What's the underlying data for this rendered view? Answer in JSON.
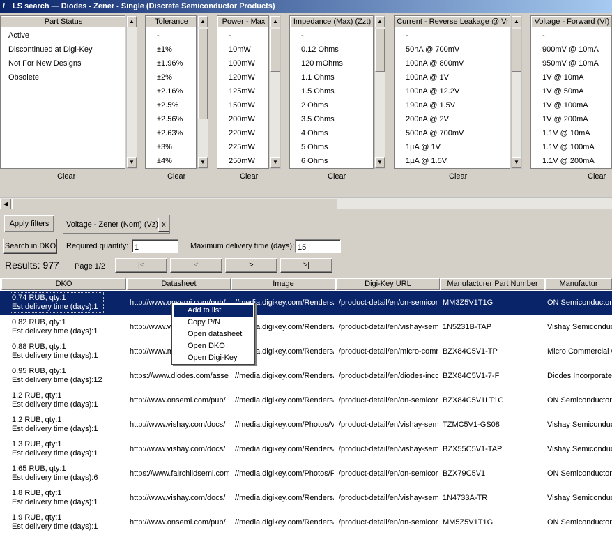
{
  "window": {
    "title": "LS search — Diodes - Zener - Single (Discrete Semiconductor Products)"
  },
  "filters": [
    {
      "header": "Part Status",
      "items": [
        "Active",
        "Discontinued at Digi-Key",
        "Not For New Designs",
        "Obsolete"
      ],
      "clear_label": "Clear"
    },
    {
      "header": "Tolerance",
      "items": [
        "-",
        "±1%",
        "±1.96%",
        "±2%",
        "±2.16%",
        "±2.5%",
        "±2.56%",
        "±2.63%",
        "±3%",
        "±4%"
      ],
      "clear_label": "Clear"
    },
    {
      "header": "Power - Max",
      "items": [
        "-",
        "10mW",
        "100mW",
        "120mW",
        "125mW",
        "150mW",
        "200mW",
        "220mW",
        "225mW",
        "250mW"
      ],
      "clear_label": "Clear"
    },
    {
      "header": "Impedance (Max) (Zzt)",
      "items": [
        "-",
        "0.12 Ohms",
        "120 mOhms",
        "1.1 Ohms",
        "1.5 Ohms",
        "2 Ohms",
        "3.5 Ohms",
        "4 Ohms",
        "5 Ohms",
        "6 Ohms"
      ],
      "clear_label": "Clear"
    },
    {
      "header": "Current - Reverse Leakage @ Vr",
      "items": [
        "-",
        "50nA @ 700mV",
        "100nA @ 800mV",
        "100nA @ 1V",
        "100nA @ 12.2V",
        "190nA @ 1.5V",
        "200nA @ 2V",
        "500nA @ 700mV",
        "1µA @ 1V",
        "1µA @ 1.5V"
      ],
      "clear_label": "Clear"
    },
    {
      "header": "Voltage - Forward (Vf)",
      "items": [
        "-",
        "900mV @ 10mA",
        "950mV @ 10mA",
        "1V @ 10mA",
        "1V @ 50mA",
        "1V @ 100mA",
        "1V @ 200mA",
        "1.1V @ 10mA",
        "1.1V @ 100mA",
        "1.1V @ 200mA"
      ],
      "clear_label": "Clear"
    }
  ],
  "controls": {
    "apply_filters": "Apply filters",
    "active_filter_chip": "Voltage - Zener (Nom) (Vz)",
    "chip_close": "x",
    "search_button": "Search in DKO",
    "required_quantity_label": "Required quantity:",
    "required_quantity_value": "1",
    "max_delivery_label": "Maximum delivery time (days):",
    "max_delivery_value": "15"
  },
  "results": {
    "summary": "Results: 977",
    "page": "Page 1/2",
    "first": "|<",
    "prev": "<",
    "next": ">",
    "last": ">|"
  },
  "grid": {
    "columns": [
      "DKO",
      "Datasheet",
      "Image",
      "Digi-Key URL",
      "Manufacturer Part Number",
      "Manufactur"
    ],
    "rows": [
      {
        "dko1": "0.74 RUB, qty:1",
        "dko2": "Est delivery time (days):1",
        "datasheet": "http://www.onsemi.com/pub/",
        "image": "//media.digikey.com/Renders/",
        "url": "/product-detail/en/on-semicor",
        "mpn": "MM3Z5V1T1G",
        "mfr": "ON Semiconductor"
      },
      {
        "dko1": "0.82 RUB, qty:1",
        "dko2": "Est delivery time (days):1",
        "datasheet": "http://www.vishay.com/docs/",
        "image": "//media.digikey.com/Renders/",
        "url": "/product-detail/en/vishay-sem",
        "mpn": "1N5231B-TAP",
        "mfr": "Vishay Semiconductor"
      },
      {
        "dko1": "0.88 RUB, qty:1",
        "dko2": "Est delivery time (days):1",
        "datasheet": "http://www.mccsemi.com/pub/",
        "image": "//media.digikey.com/Renders/",
        "url": "/product-detail/en/micro-comr",
        "mpn": "BZX84C5V1-TP",
        "mfr": "Micro Commercial C"
      },
      {
        "dko1": "0.95 RUB, qty:1",
        "dko2": "Est delivery time (days):12",
        "datasheet": "https://www.diodes.com/asse",
        "image": "//media.digikey.com/Renders/",
        "url": "/product-detail/en/diodes-incc",
        "mpn": "BZX84C5V1-7-F",
        "mfr": "Diodes Incorporate"
      },
      {
        "dko1": "1.2 RUB, qty:1",
        "dko2": "Est delivery time (days):1",
        "datasheet": "http://www.onsemi.com/pub/",
        "image": "//media.digikey.com/Renders/",
        "url": "/product-detail/en/on-semicor",
        "mpn": "BZX84C5V1LT1G",
        "mfr": "ON Semiconductor"
      },
      {
        "dko1": "1.2 RUB, qty:1",
        "dko2": "Est delivery time (days):1",
        "datasheet": "http://www.vishay.com/docs/",
        "image": "//media.digikey.com/Photos/V",
        "url": "/product-detail/en/vishay-sem",
        "mpn": "TZMC5V1-GS08",
        "mfr": "Vishay Semiconductor"
      },
      {
        "dko1": "1.3 RUB, qty:1",
        "dko2": "Est delivery time (days):1",
        "datasheet": "http://www.vishay.com/docs/",
        "image": "//media.digikey.com/Renders/",
        "url": "/product-detail/en/vishay-sem",
        "mpn": "BZX55C5V1-TAP",
        "mfr": "Vishay Semiconductor"
      },
      {
        "dko1": "1.65 RUB, qty:1",
        "dko2": "Est delivery time (days):6",
        "datasheet": "https://www.fairchildsemi.com",
        "image": "//media.digikey.com/Photos/F",
        "url": "/product-detail/en/on-semicor",
        "mpn": "BZX79C5V1",
        "mfr": "ON Semiconductor"
      },
      {
        "dko1": "1.8 RUB, qty:1",
        "dko2": "Est delivery time (days):1",
        "datasheet": "http://www.vishay.com/docs/",
        "image": "//media.digikey.com/Renders/",
        "url": "/product-detail/en/vishay-sem",
        "mpn": "1N4733A-TR",
        "mfr": "Vishay Semiconductor"
      },
      {
        "dko1": "1.9 RUB, qty:1",
        "dko2": "Est delivery time (days):1",
        "datasheet": "http://www.onsemi.com/pub/",
        "image": "//media.digikey.com/Renders/",
        "url": "/product-detail/en/on-semicor",
        "mpn": "MM5Z5V1T1G",
        "mfr": "ON Semiconductor"
      }
    ]
  },
  "context_menu": {
    "items": [
      "Add to list",
      "Copy P/N",
      "Open datasheet",
      "Open DKO",
      "Open Digi-Key"
    ]
  }
}
